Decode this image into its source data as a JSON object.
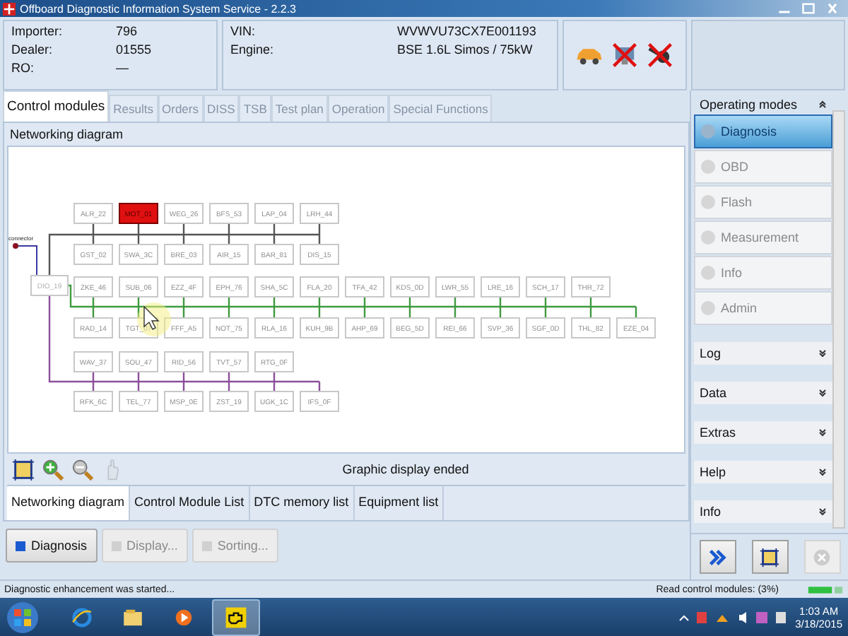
{
  "window": {
    "title": "Offboard Diagnostic Information System Service - 2.2.3"
  },
  "header": {
    "left": [
      {
        "label": "Importer:",
        "value": "796"
      },
      {
        "label": "Dealer:",
        "value": "01555"
      },
      {
        "label": "RO:",
        "value": "—"
      }
    ],
    "vehicle": [
      {
        "label": "VIN:",
        "value": "WVWVU73CX7E001193"
      },
      {
        "label": "Engine:",
        "value": "BSE 1.6L Simos / 75kW"
      }
    ],
    "status_icons": [
      {
        "kind": "car",
        "connected": true
      },
      {
        "kind": "monitor",
        "connected": false
      },
      {
        "kind": "plug",
        "connected": false
      }
    ]
  },
  "tabs": [
    {
      "label": "Control modules",
      "selected": true,
      "disabled": false
    },
    {
      "label": "Results",
      "selected": false,
      "disabled": true
    },
    {
      "label": "Orders",
      "selected": false,
      "disabled": true
    },
    {
      "label": "DISS",
      "selected": false,
      "disabled": true
    },
    {
      "label": "TSB",
      "selected": false,
      "disabled": true
    },
    {
      "label": "Test plan",
      "selected": false,
      "disabled": true
    },
    {
      "label": "Operation",
      "selected": false,
      "disabled": true
    },
    {
      "label": "Special Functions",
      "selected": false,
      "disabled": true
    }
  ],
  "diagram": {
    "title": "Networking diagram",
    "connector_label": "connector",
    "gateway": "DIO_19",
    "buses": [
      {
        "color": "#555555",
        "upper": [
          {
            "label": "ALR_22",
            "error": false
          },
          {
            "label": "MOT_01",
            "error": true
          },
          {
            "label": "WEG_26",
            "error": false
          },
          {
            "label": "BFS_53",
            "error": false
          },
          {
            "label": "LAP_04",
            "error": false
          },
          {
            "label": "LRH_44",
            "error": false
          }
        ],
        "lower": [
          {
            "label": "GST_02",
            "error": false
          },
          {
            "label": "SWA_3C",
            "error": false
          },
          {
            "label": "BRE_03",
            "error": false
          },
          {
            "label": "AIR_15",
            "error": false
          },
          {
            "label": "BAR_81",
            "error": false
          },
          {
            "label": "DIS_15",
            "error": false
          }
        ]
      },
      {
        "color": "#3f9a3f",
        "upper": [
          {
            "label": "ZKE_46",
            "error": false
          },
          {
            "label": "SUB_06",
            "error": false
          },
          {
            "label": "EZZ_4F",
            "error": false
          },
          {
            "label": "EPH_76",
            "error": false
          },
          {
            "label": "SHA_5C",
            "error": false
          },
          {
            "label": "FLA_20",
            "error": false
          },
          {
            "label": "TFA_42",
            "error": false
          },
          {
            "label": "KDS_0D",
            "error": false
          },
          {
            "label": "LWR_55",
            "error": false
          },
          {
            "label": "LRE_16",
            "error": false
          },
          {
            "label": "SCH_17",
            "error": false
          },
          {
            "label": "THR_72",
            "error": false
          }
        ],
        "lower": [
          {
            "label": "RAD_14",
            "error": false
          },
          {
            "label": "TGT_07",
            "error": false
          },
          {
            "label": "FFF_A5",
            "error": false
          },
          {
            "label": "NOT_75",
            "error": false
          },
          {
            "label": "RLA_16",
            "error": false
          },
          {
            "label": "KUH_9B",
            "error": false
          },
          {
            "label": "AHP_69",
            "error": false
          },
          {
            "label": "BEG_5D",
            "error": false
          },
          {
            "label": "REI_66",
            "error": false
          },
          {
            "label": "SVP_36",
            "error": false
          },
          {
            "label": "SGF_0D",
            "error": false
          },
          {
            "label": "THL_82",
            "error": false
          },
          {
            "label": "EZE_04",
            "error": false
          }
        ]
      },
      {
        "color": "#8a4f9a",
        "upper": [
          {
            "label": "WAV_37",
            "error": false
          },
          {
            "label": "SOU_47",
            "error": false
          },
          {
            "label": "RID_56",
            "error": false
          },
          {
            "label": "TVT_57",
            "error": false
          },
          {
            "label": "RTG_0F",
            "error": false
          }
        ],
        "lower": [
          {
            "label": "RFK_6C",
            "error": false
          },
          {
            "label": "TEL_77",
            "error": false
          },
          {
            "label": "MSP_0E",
            "error": false
          },
          {
            "label": "ZST_19",
            "error": false
          },
          {
            "label": "UGK_1C",
            "error": false
          },
          {
            "label": "IFS_0F",
            "error": false
          }
        ]
      }
    ],
    "tools": [
      {
        "kind": "fit",
        "disabled": false
      },
      {
        "kind": "zoom-in",
        "disabled": false
      },
      {
        "kind": "zoom-out",
        "disabled": false
      },
      {
        "kind": "hand",
        "disabled": true
      }
    ],
    "status": "Graphic display ended"
  },
  "view_tabs": [
    {
      "label": "Networking diagram",
      "selected": true
    },
    {
      "label": "Control Module List",
      "selected": false
    },
    {
      "label": "DTC memory list",
      "selected": false
    },
    {
      "label": "Equipment list",
      "selected": false
    }
  ],
  "buttons": [
    {
      "label": "Diagnosis",
      "disabled": false
    },
    {
      "label": "Display...",
      "disabled": true
    },
    {
      "label": "Sorting...",
      "disabled": true
    }
  ],
  "sidebar": {
    "sections": [
      {
        "label": "Operating modes",
        "expanded": true
      },
      {
        "label": "Log",
        "expanded": false
      },
      {
        "label": "Data",
        "expanded": false
      },
      {
        "label": "Extras",
        "expanded": false
      },
      {
        "label": "Help",
        "expanded": false
      },
      {
        "label": "Info",
        "expanded": false
      }
    ],
    "modes": [
      {
        "label": "Diagnosis",
        "selected": true,
        "disabled": false
      },
      {
        "label": "OBD",
        "selected": false,
        "disabled": true
      },
      {
        "label": "Flash",
        "selected": false,
        "disabled": true
      },
      {
        "label": "Measurement",
        "selected": false,
        "disabled": true
      },
      {
        "label": "Info",
        "selected": false,
        "disabled": true
      },
      {
        "label": "Admin",
        "selected": false,
        "disabled": true
      }
    ],
    "actions": [
      {
        "kind": "forward",
        "disabled": false
      },
      {
        "kind": "fit",
        "disabled": false
      },
      {
        "kind": "cancel",
        "disabled": true
      }
    ]
  },
  "status_bar": {
    "message": "Diagnostic enhancement was started...",
    "progress": "Read control modules: (3%)"
  },
  "taskbar": {
    "apps": [
      {
        "kind": "browser",
        "active": false
      },
      {
        "kind": "folder",
        "active": false
      },
      {
        "kind": "media",
        "active": false
      },
      {
        "kind": "engine",
        "active": true
      }
    ],
    "time": "1:03 AM",
    "date": "3/18/2015"
  }
}
